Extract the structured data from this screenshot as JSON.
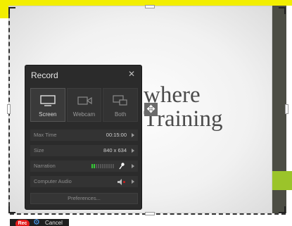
{
  "slide": {
    "text": "where\nTraining"
  },
  "panel": {
    "title": "Record",
    "close_glyph": "✕",
    "sources": [
      {
        "label": "Screen",
        "icon": "monitor-icon",
        "active": true
      },
      {
        "label": "Webcam",
        "icon": "webcam-icon",
        "active": false
      },
      {
        "label": "Both",
        "icon": "screen-and-webcam-icon",
        "active": false
      }
    ],
    "settings": {
      "max_time": {
        "label": "Max Time",
        "value": "00:15:00"
      },
      "size": {
        "label": "Size",
        "value": "840 x 634"
      },
      "narration": {
        "label": "Narration",
        "level_fraction": 0.15
      },
      "computer_audio": {
        "label": "Computer Audio"
      }
    },
    "preferences_label": "Preferences..."
  },
  "toolbar": {
    "rec_label": "Rec",
    "gear_glyph": "⚙",
    "cancel_label": "Cancel"
  },
  "colors": {
    "accent_yellow": "#f2ee00",
    "record_red": "#e21b1b",
    "meter_green": "#36c936",
    "slide_green": "#9bc42a",
    "panel_bg": "#2b2b2b"
  }
}
